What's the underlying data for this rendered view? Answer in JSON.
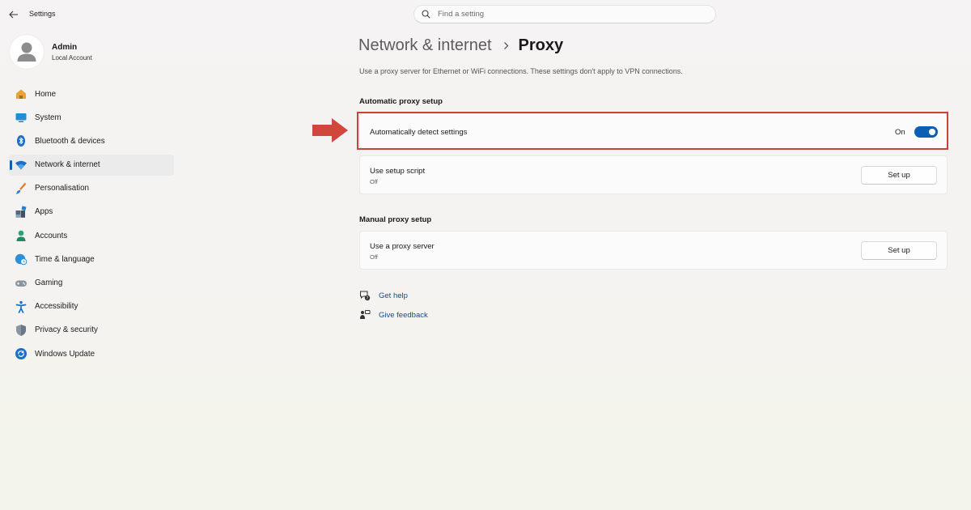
{
  "window": {
    "title": "Settings"
  },
  "search": {
    "placeholder": "Find a setting"
  },
  "profile": {
    "name": "Admin",
    "account_type": "Local Account"
  },
  "sidebar": {
    "items": [
      {
        "label": "Home",
        "icon": "home-icon"
      },
      {
        "label": "System",
        "icon": "system-icon"
      },
      {
        "label": "Bluetooth & devices",
        "icon": "bluetooth-icon"
      },
      {
        "label": "Network & internet",
        "icon": "network-icon",
        "active": true
      },
      {
        "label": "Personalisation",
        "icon": "brush-icon"
      },
      {
        "label": "Apps",
        "icon": "apps-icon"
      },
      {
        "label": "Accounts",
        "icon": "accounts-icon"
      },
      {
        "label": "Time & language",
        "icon": "globe-clock-icon"
      },
      {
        "label": "Gaming",
        "icon": "gamepad-icon"
      },
      {
        "label": "Accessibility",
        "icon": "accessibility-icon"
      },
      {
        "label": "Privacy & security",
        "icon": "shield-icon"
      },
      {
        "label": "Windows Update",
        "icon": "update-icon"
      }
    ]
  },
  "header": {
    "parent": "Network & internet",
    "current": "Proxy"
  },
  "description": "Use a proxy server for Ethernet or WiFi connections. These settings don't apply to VPN connections.",
  "automatic": {
    "heading": "Automatic proxy setup",
    "detect": {
      "label": "Automatically detect settings",
      "state": "On",
      "enabled": true
    },
    "script": {
      "label": "Use setup script",
      "status": "Off",
      "button": "Set up"
    }
  },
  "manual": {
    "heading": "Manual proxy setup",
    "proxy": {
      "label": "Use a proxy server",
      "status": "Off",
      "button": "Set up"
    }
  },
  "links": {
    "help": "Get help",
    "feedback": "Give feedback"
  },
  "colors": {
    "accent": "#0a5fb4",
    "highlight": "#c4453b",
    "link": "#0a4e9a"
  }
}
